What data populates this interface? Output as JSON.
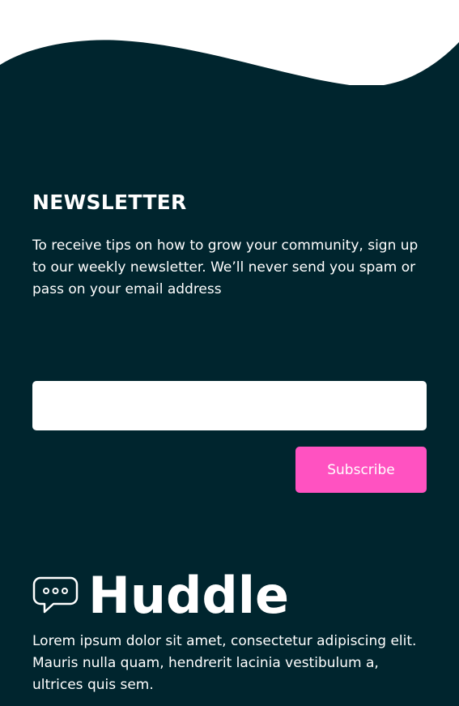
{
  "newsletter": {
    "title": "NEWSLETTER",
    "description": "To receive tips on how to grow your community, sign up to our weekly newsletter. We’ll never send you spam or pass on your email address",
    "email_value": "",
    "subscribe_label": "Subscribe"
  },
  "brand": {
    "name": "Huddle",
    "icon": "chat-bubble-icon",
    "about": "Lorem ipsum dolor sit amet, consectetur adipiscing elit. Mauris nulla quam, hendrerit lacinia vestibulum a, ultrices quis sem."
  },
  "colors": {
    "page_background": "#ffffff",
    "footer_background": "#00252e",
    "accent": "#ff52c1",
    "text": "#ffffff"
  }
}
